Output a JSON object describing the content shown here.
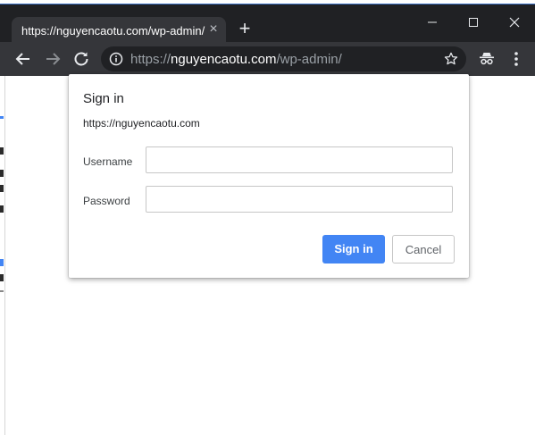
{
  "browser": {
    "tab": {
      "title": "https://nguyencaotu.com/wp-admin/",
      "close_icon": "×"
    },
    "new_tab_icon": "+",
    "window_controls": [
      "minimize",
      "maximize",
      "close"
    ],
    "address_bar": {
      "scheme": "https://",
      "host": "nguyencaotu.com",
      "path": "/wp-admin/"
    }
  },
  "dialog": {
    "title": "Sign in",
    "origin": "https://nguyencaotu.com",
    "username_label": "Username",
    "username_value": "",
    "password_label": "Password",
    "password_value": "",
    "sign_in_label": "Sign in",
    "cancel_label": "Cancel"
  },
  "colors": {
    "titlebar": "#202124",
    "toolbar": "#35363a",
    "primary_button": "#4285f4"
  }
}
